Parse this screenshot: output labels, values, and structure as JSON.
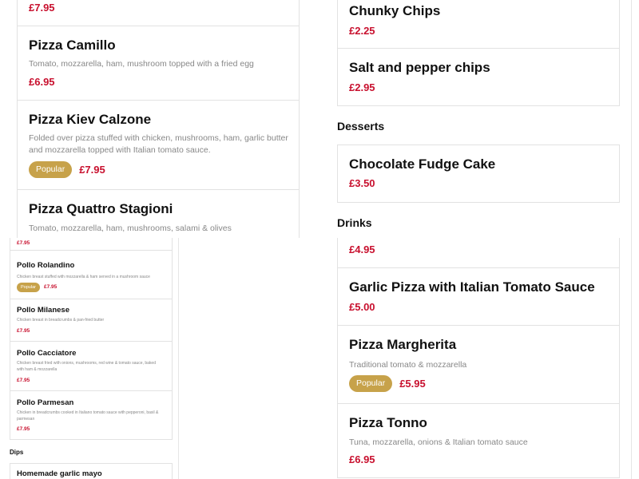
{
  "top_left": {
    "prev_price": "£7.95",
    "items": [
      {
        "name": "Pizza Camillo",
        "desc": "Tomato, mozzarella, ham, mushroom topped with a fried egg",
        "price": "£6.95"
      },
      {
        "name": "Pizza Kiev Calzone",
        "desc": "Folded over pizza stuffed with chicken, mushrooms, ham, garlic butter and mozzarella topped with Italian tomato sauce.",
        "badge": "Popular",
        "price": "£7.95"
      },
      {
        "name": "Pizza Quattro Stagioni",
        "desc": "Tomato, mozzarella, ham, mushrooms, salami & olives"
      }
    ]
  },
  "top_right": {
    "sides": [
      {
        "name": "Chunky Chips",
        "price": "£2.25"
      },
      {
        "name": "Salt and pepper chips",
        "price": "£2.95"
      }
    ],
    "desserts_heading": "Desserts",
    "desserts": [
      {
        "name": "Chocolate Fudge Cake",
        "price": "£3.50"
      }
    ],
    "drinks_heading": "Drinks"
  },
  "bottom_left": {
    "prev_price": "£7.95",
    "items": [
      {
        "name": "Pollo Rolandino",
        "desc": "Chicken breast stuffed with mozzarella & ham served in a mushroom sauce",
        "badge": "Popular",
        "price": "£7.95"
      },
      {
        "name": "Pollo Milanese",
        "desc": "Chicken breast in breadcrumbs & pan-fried butter",
        "price": "£7.95"
      },
      {
        "name": "Pollo Cacciatore",
        "desc": "Chicken breast fried with onions, mushrooms, red wine & tomato sauce, baked with ham & mozzarella",
        "price": "£7.95"
      },
      {
        "name": "Pollo Parmesan",
        "desc": "Chicken in breadcrumbs cooked in Italiano tomato sauce with pepperoni, basil & parmesan",
        "price": "£7.95"
      }
    ],
    "dips_heading": "Dips",
    "dips": [
      {
        "name": "Homemade garlic mayo"
      }
    ]
  },
  "bottom_right": {
    "prev_price": "£4.95",
    "items": [
      {
        "name": "Garlic Pizza with Italian Tomato Sauce",
        "price": "£5.00"
      },
      {
        "name": "Pizza Margherita",
        "desc": "Traditional tomato & mozzarella",
        "badge": "Popular",
        "price": "£5.95"
      },
      {
        "name": "Pizza Tonno",
        "desc": "Tuna, mozzarella, onions & Italian tomato sauce",
        "price": "£6.95"
      }
    ]
  },
  "colors": {
    "price": "#c8102e",
    "badge": "#c7a24a",
    "border": "#e2e2e2"
  }
}
